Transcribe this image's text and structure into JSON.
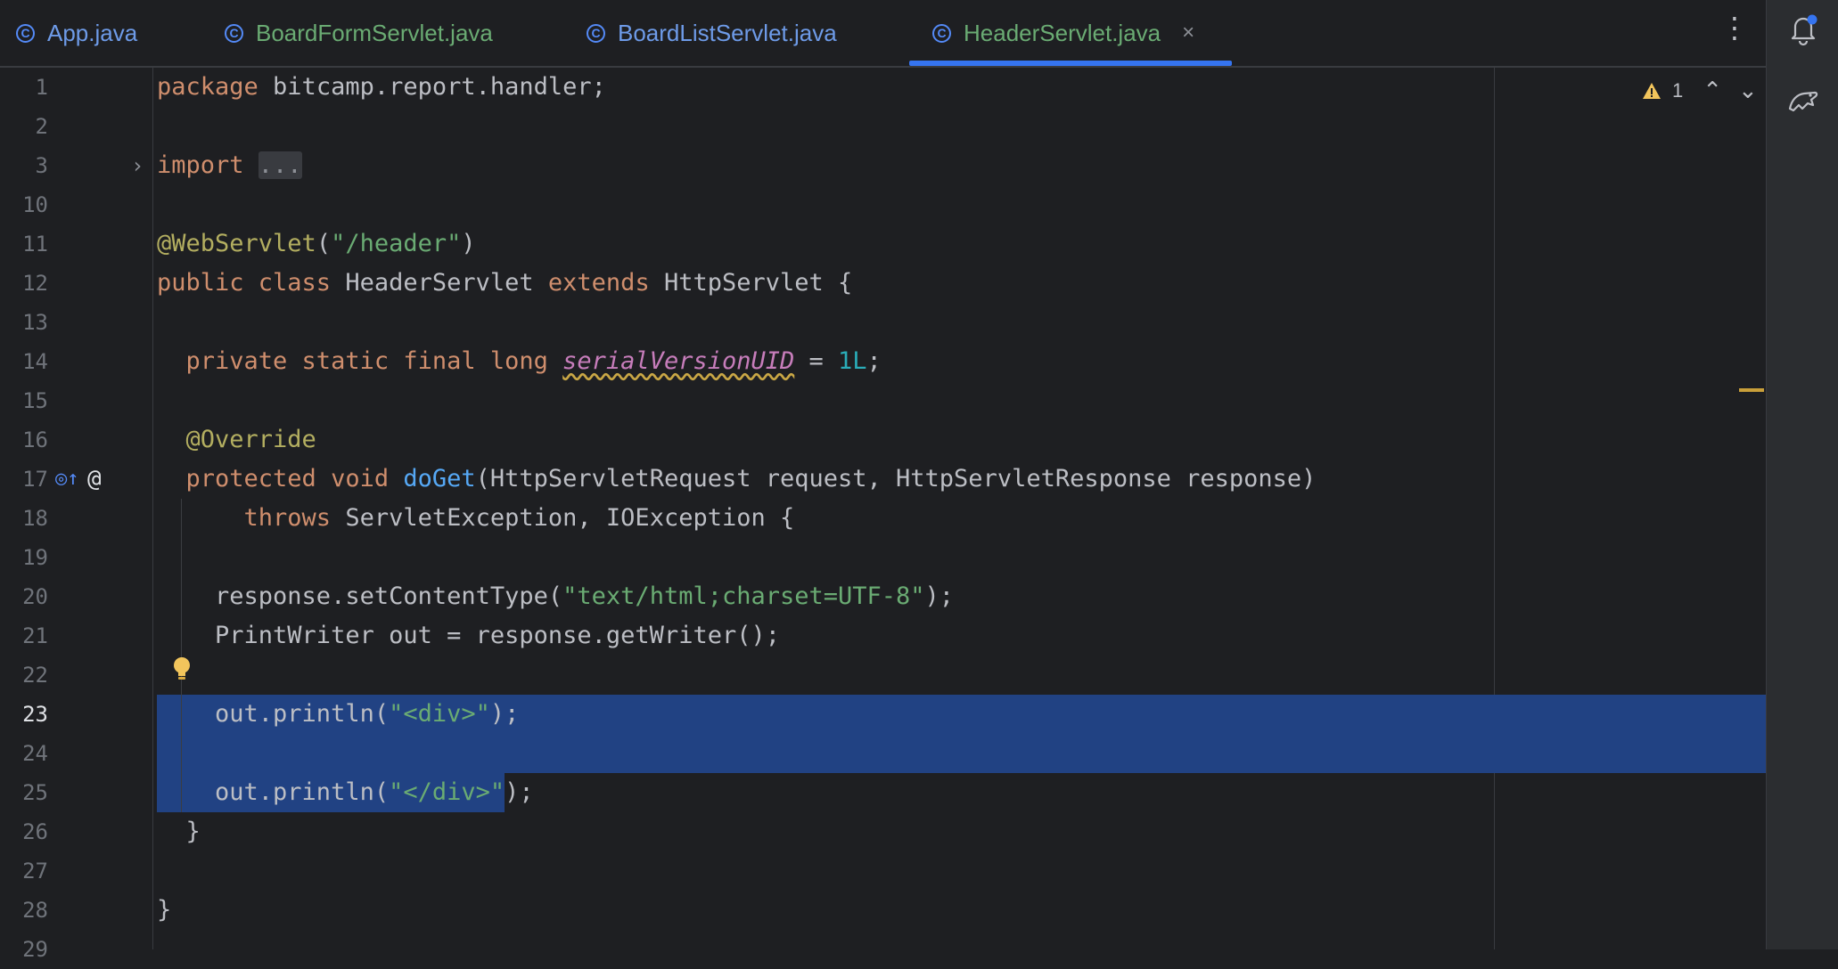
{
  "tabs": [
    {
      "label": "App.java",
      "active": false
    },
    {
      "label": "BoardFormServlet.java",
      "active": false
    },
    {
      "label": "BoardListServlet.java",
      "active": false
    },
    {
      "label": "HeaderServlet.java",
      "active": true
    }
  ],
  "icons": {
    "tab_icon": "c-class-icon",
    "tab_close": "close-icon",
    "more": "more-vertical-icon",
    "notifications": "bell-icon",
    "assistant": "ai-assistant-icon",
    "warning": "warning-icon",
    "bulb": "lightbulb-icon",
    "override": "override-marker-icon",
    "annotation": "at-sign-icon"
  },
  "glyphs": {
    "close": "×",
    "more": "⋮",
    "fold": "›",
    "override_mark": "◎↑",
    "at": "@",
    "chev_up": "⌃",
    "chev_down": "⌄"
  },
  "inspection": {
    "warnings": "1"
  },
  "editor": {
    "current_line": "23",
    "lines": [
      {
        "n": "1",
        "parts": [
          {
            "t": "package ",
            "c": "k"
          },
          {
            "t": "bitcamp.report.handler;",
            "c": ""
          }
        ]
      },
      {
        "n": "2",
        "parts": []
      },
      {
        "n": "3",
        "parts": [
          {
            "t": "import ",
            "c": "k"
          },
          {
            "t": "...",
            "c": "fold-chip"
          }
        ]
      },
      {
        "n": "10",
        "parts": []
      },
      {
        "n": "11",
        "parts": [
          {
            "t": "@WebServlet",
            "c": "a"
          },
          {
            "t": "(",
            "c": ""
          },
          {
            "t": "\"/header\"",
            "c": "s"
          },
          {
            "t": ")",
            "c": ""
          }
        ]
      },
      {
        "n": "12",
        "parts": [
          {
            "t": "public class ",
            "c": "k"
          },
          {
            "t": "HeaderServlet ",
            "c": ""
          },
          {
            "t": "extends ",
            "c": "k"
          },
          {
            "t": "HttpServlet {",
            "c": ""
          }
        ]
      },
      {
        "n": "13",
        "parts": []
      },
      {
        "n": "14",
        "parts": [
          {
            "t": "  private static final long ",
            "c": "k"
          },
          {
            "t": "serialVersionUID",
            "c": "sv"
          },
          {
            "t": " = ",
            "c": ""
          },
          {
            "t": "1L",
            "c": "n"
          },
          {
            "t": ";",
            "c": ""
          }
        ]
      },
      {
        "n": "15",
        "parts": []
      },
      {
        "n": "16",
        "parts": [
          {
            "t": "  @Override",
            "c": "a"
          }
        ]
      },
      {
        "n": "17",
        "parts": [
          {
            "t": "  protected void ",
            "c": "k"
          },
          {
            "t": "doGet",
            "c": "f"
          },
          {
            "t": "(HttpServletRequest request, HttpServletResponse response)",
            "c": ""
          }
        ]
      },
      {
        "n": "18",
        "parts": [
          {
            "t": "      throws ",
            "c": "k"
          },
          {
            "t": "ServletException, IOException {",
            "c": ""
          }
        ]
      },
      {
        "n": "19",
        "parts": []
      },
      {
        "n": "20",
        "parts": [
          {
            "t": "    response.setContentType(",
            "c": ""
          },
          {
            "t": "\"text/html;charset=UTF-8\"",
            "c": "s"
          },
          {
            "t": ");",
            "c": ""
          }
        ]
      },
      {
        "n": "21",
        "parts": [
          {
            "t": "    PrintWriter out = response.getWriter();",
            "c": ""
          }
        ]
      },
      {
        "n": "22",
        "parts": []
      },
      {
        "n": "23",
        "parts": [
          {
            "t": "    out.println(",
            "c": ""
          },
          {
            "t": "\"<div>\"",
            "c": "s"
          },
          {
            "t": ");",
            "c": ""
          }
        ]
      },
      {
        "n": "24",
        "parts": []
      },
      {
        "n": "25",
        "parts": [
          {
            "t": "    out.println(",
            "c": ""
          },
          {
            "t": "\"</div>\"",
            "c": "s"
          },
          {
            "t": ");",
            "c": ""
          }
        ]
      },
      {
        "n": "26",
        "parts": [
          {
            "t": "  }",
            "c": ""
          }
        ]
      },
      {
        "n": "27",
        "parts": []
      },
      {
        "n": "28",
        "parts": [
          {
            "t": "}",
            "c": ""
          }
        ]
      },
      {
        "n": "29",
        "parts": []
      }
    ]
  }
}
